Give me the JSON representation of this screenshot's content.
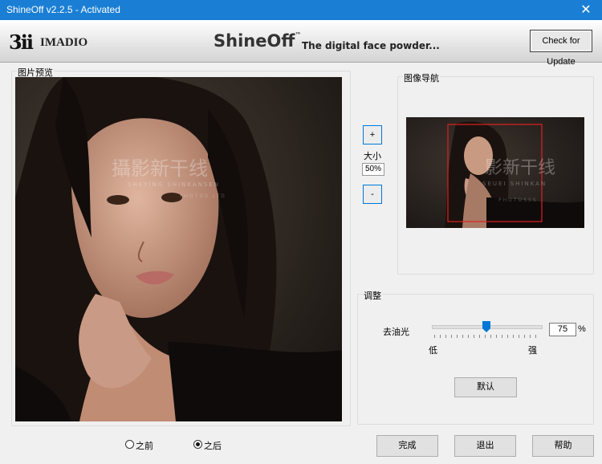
{
  "window": {
    "title": "ShineOff v2.2.5 - Activated",
    "close_glyph": "✕"
  },
  "banner": {
    "logo_mark": "3ii",
    "logo_text": "IMADIO",
    "brand": "ShineOff",
    "trademark": "™",
    "tagline": "The digital face powder...",
    "check_update_label": "Check for Update"
  },
  "preview": {
    "legend": "图片预览",
    "watermark_main": "攝影新干线",
    "watermark_sub": "SHEYING SHINKANSEN",
    "watermark_tail": "PHOTOS.LTD"
  },
  "zoom": {
    "plus_label": "+",
    "size_label": "大小",
    "zoom_value": "50%",
    "minus_label": "-"
  },
  "navigator": {
    "legend": "图像导航",
    "watermark_main": "影新干线",
    "watermark_sub": "SEUEI SHINKAN",
    "watermark_tail": "PHOTOSSS"
  },
  "adjust": {
    "legend": "调整",
    "degloss_label": "去油光",
    "low_label": "低",
    "high_label": "强",
    "value": "75",
    "unit": "%",
    "slider_fraction": 0.5,
    "default_label": "默认"
  },
  "view_mode": {
    "before_label": "之前",
    "after_label": "之后",
    "selected": "之后"
  },
  "footer": {
    "done_label": "完成",
    "exit_label": "退出",
    "help_label": "帮助"
  },
  "colors": {
    "titlebar": "#1a7fd4",
    "accent": "#0078d7",
    "nav_frame": "#e02020"
  }
}
